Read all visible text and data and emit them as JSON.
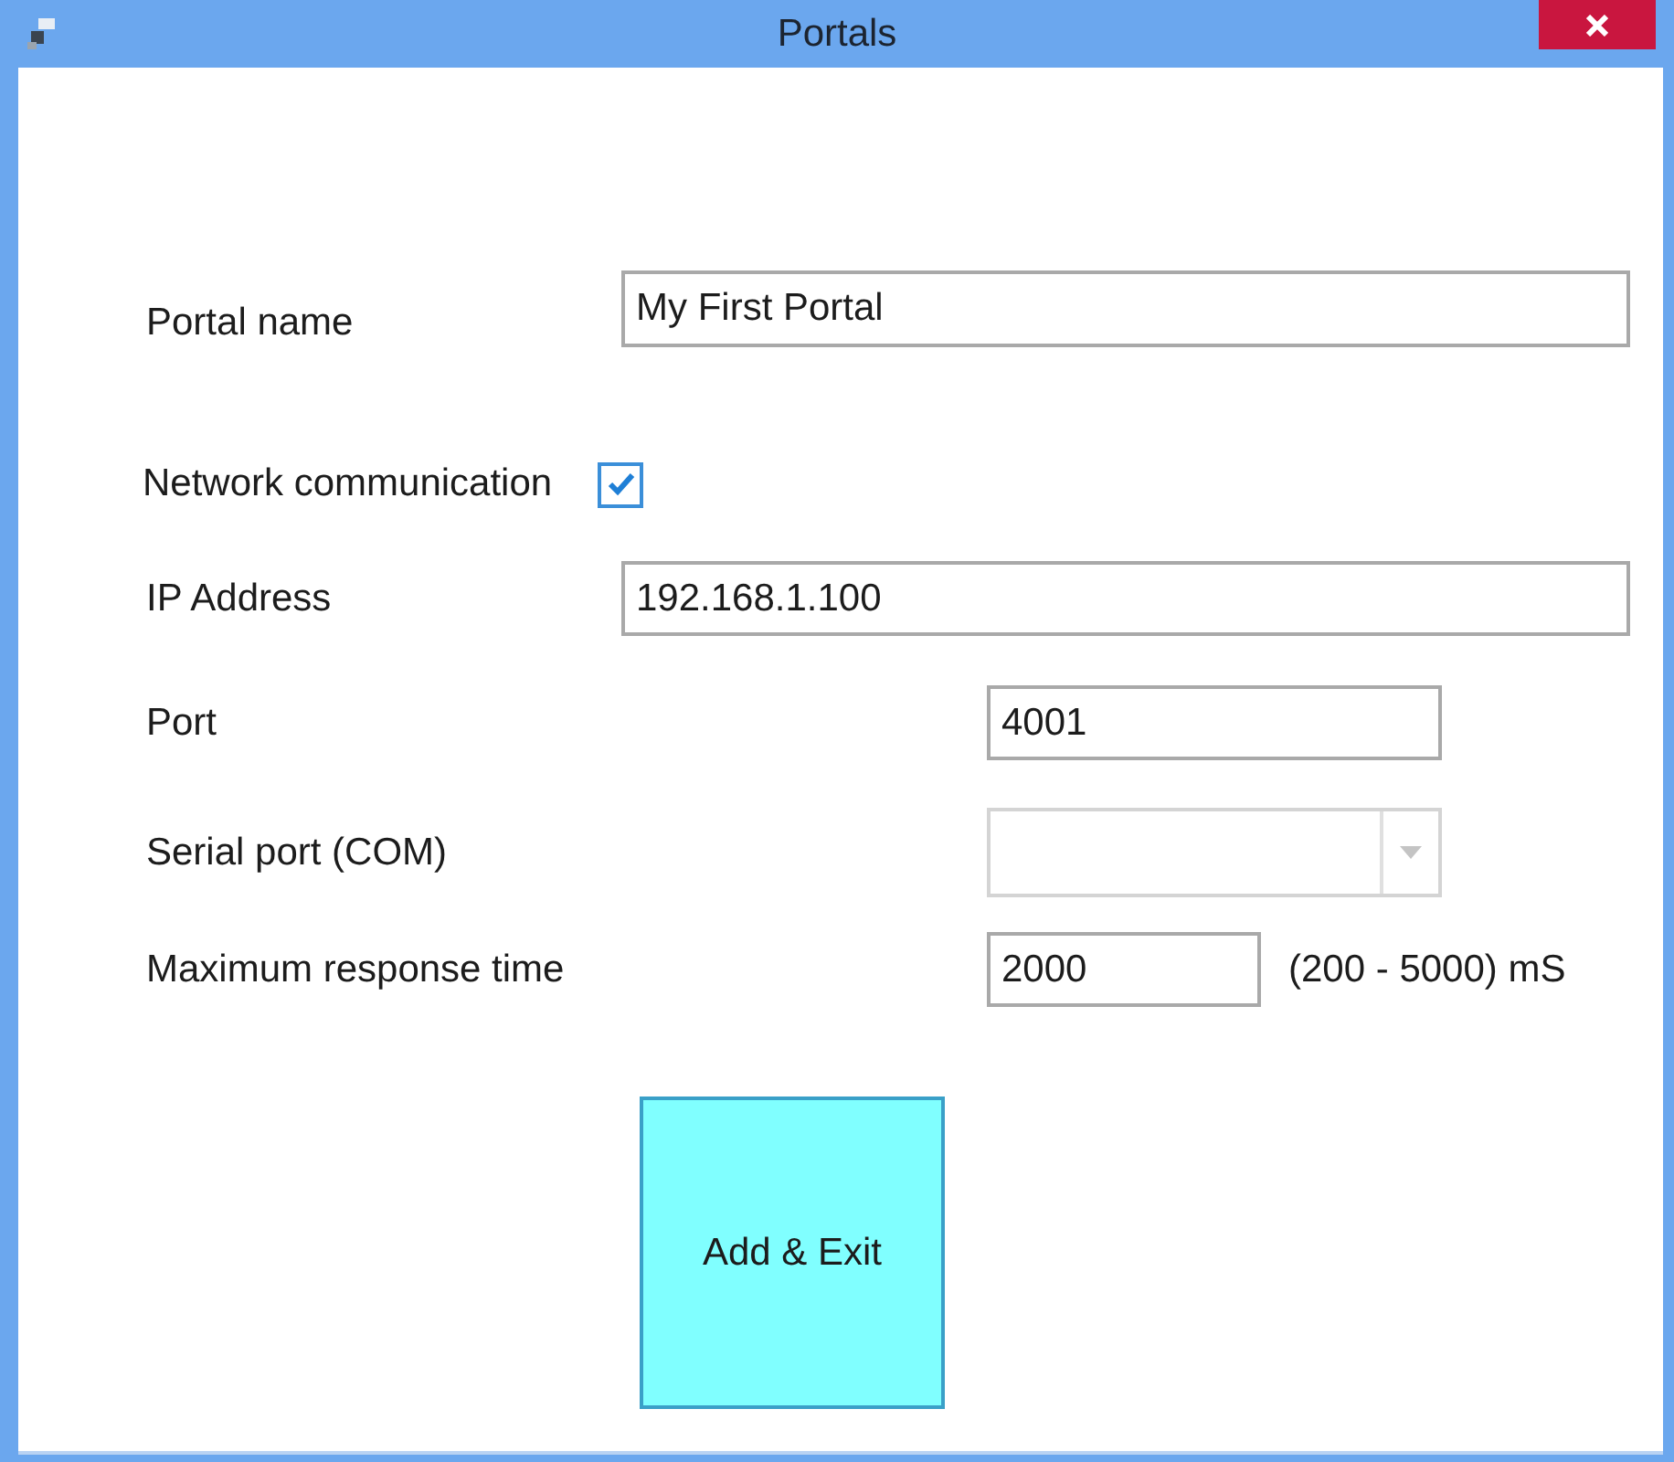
{
  "window": {
    "title": "Portals"
  },
  "fields": [
    {
      "kind": "text",
      "label": "Portal name",
      "value": "My First Portal"
    },
    {
      "kind": "checkbox",
      "label": "Network communication",
      "checked": true
    },
    {
      "kind": "text",
      "label": "IP Address",
      "value": "192.168.1.100"
    },
    {
      "kind": "short",
      "label": "Port",
      "value": "4001"
    },
    {
      "kind": "combo",
      "label": "Serial port (COM)",
      "disabled": true
    },
    {
      "kind": "tiny",
      "label": "Maximum response time",
      "value": "2000",
      "suffix": "(200 - 5000) mS"
    }
  ],
  "buttons": [
    {
      "label": "Add & Exit"
    }
  ]
}
